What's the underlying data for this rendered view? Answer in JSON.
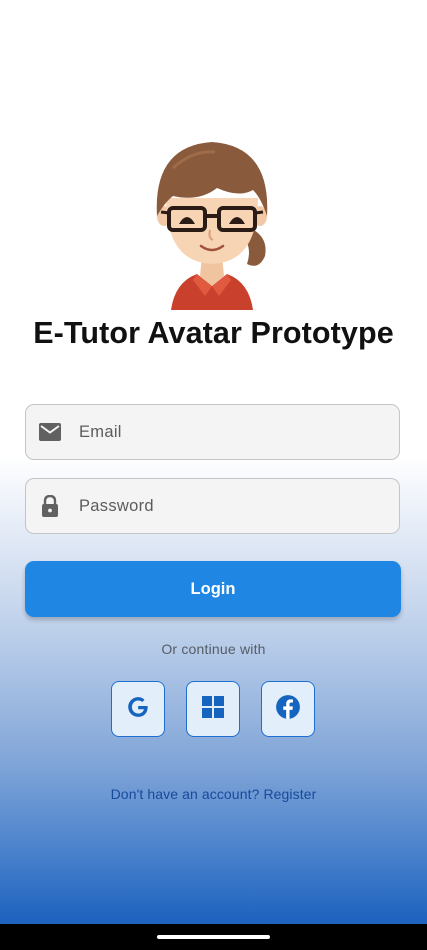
{
  "app": {
    "title": "E-Tutor Avatar Prototype"
  },
  "login_form": {
    "email_placeholder": "Email",
    "password_placeholder": "Password",
    "email_icon": "mail-icon",
    "password_icon": "lock-icon",
    "login_label": "Login"
  },
  "social": {
    "divider_text": "Or continue with",
    "buttons": [
      {
        "icon": "google-icon"
      },
      {
        "icon": "windows-icon"
      },
      {
        "icon": "facebook-icon"
      }
    ]
  },
  "register": {
    "link_text": "Don't have an account? Register"
  },
  "colors": {
    "primary": "#1f86e3",
    "link": "#174a9c",
    "social_border": "#1e6fd0",
    "social_bg": "#e3eefb",
    "gradient_bottom": "#1e63bf"
  }
}
